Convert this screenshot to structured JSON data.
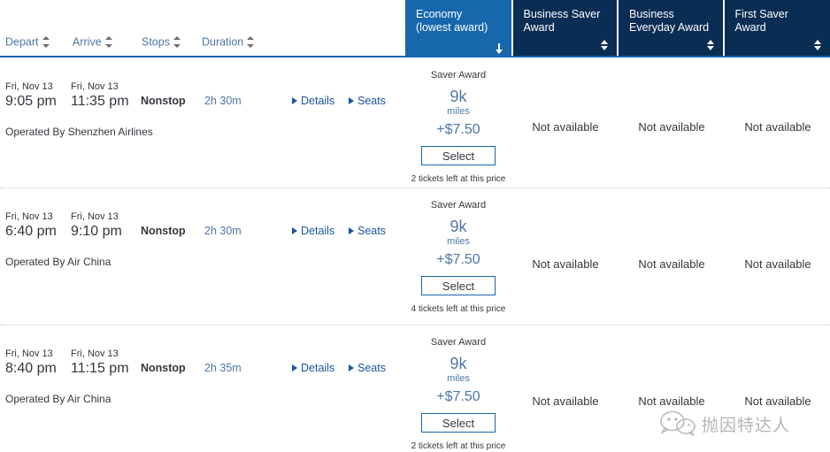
{
  "fare_tabs": [
    {
      "label": "Economy\n(lowest award)",
      "state": "selected",
      "sort": "down"
    },
    {
      "label": "Business Saver\nAward",
      "state": "default",
      "sort": "both"
    },
    {
      "label": "Business\nEveryday Award",
      "state": "default",
      "sort": "both"
    },
    {
      "label": "First Saver Award",
      "state": "default",
      "sort": "both"
    }
  ],
  "column_headers": [
    {
      "label": "Depart"
    },
    {
      "label": "Arrive"
    },
    {
      "label": "Stops"
    },
    {
      "label": "Duration"
    }
  ],
  "links": {
    "details": "Details",
    "seats": "Seats"
  },
  "labels": {
    "not_available": "Not available",
    "select": "Select",
    "miles_unit": "miles"
  },
  "flights": [
    {
      "depart": {
        "day": "Fri, Nov 13",
        "time": "9:05 pm"
      },
      "arrive": {
        "day": "Fri, Nov 13",
        "time": "11:35 pm"
      },
      "stops": "Nonstop",
      "duration": "2h 30m",
      "operated_by": "Operated By Shenzhen Airlines",
      "economy": {
        "award_name": "Saver Award",
        "miles": "9k",
        "miles_unit": "miles",
        "tax": "+$7.50",
        "select": "Select",
        "tickets_left": "2 tickets left at this price"
      },
      "business_saver": "Not available",
      "business_everyday": "Not available",
      "first_saver": "Not available"
    },
    {
      "depart": {
        "day": "Fri, Nov 13",
        "time": "6:40 pm"
      },
      "arrive": {
        "day": "Fri, Nov 13",
        "time": "9:10 pm"
      },
      "stops": "Nonstop",
      "duration": "2h 30m",
      "operated_by": "Operated By Air China",
      "economy": {
        "award_name": "Saver Award",
        "miles": "9k",
        "miles_unit": "miles",
        "tax": "+$7.50",
        "select": "Select",
        "tickets_left": "4 tickets left at this price"
      },
      "business_saver": "Not available",
      "business_everyday": "Not available",
      "first_saver": "Not available"
    },
    {
      "depart": {
        "day": "Fri, Nov 13",
        "time": "8:40 pm"
      },
      "arrive": {
        "day": "Fri, Nov 13",
        "time": "11:15 pm"
      },
      "stops": "Nonstop",
      "duration": "2h 35m",
      "operated_by": "Operated By Air China",
      "economy": {
        "award_name": "Saver Award",
        "miles": "9k",
        "miles_unit": "miles",
        "tax": "+$7.50",
        "select": "Select",
        "tickets_left": "2 tickets left at this price"
      },
      "business_saver": "Not available",
      "business_everyday": "Not available",
      "first_saver": "Not available"
    }
  ],
  "watermark": {
    "text": "抛因特达人",
    "icon": "wechat-icon"
  },
  "colors": {
    "tab_selected": "#1767ad",
    "tab_default": "#0a2d54",
    "link_blue": "#17569e",
    "muted_blue": "#4d77a8",
    "text": "#32373e"
  }
}
